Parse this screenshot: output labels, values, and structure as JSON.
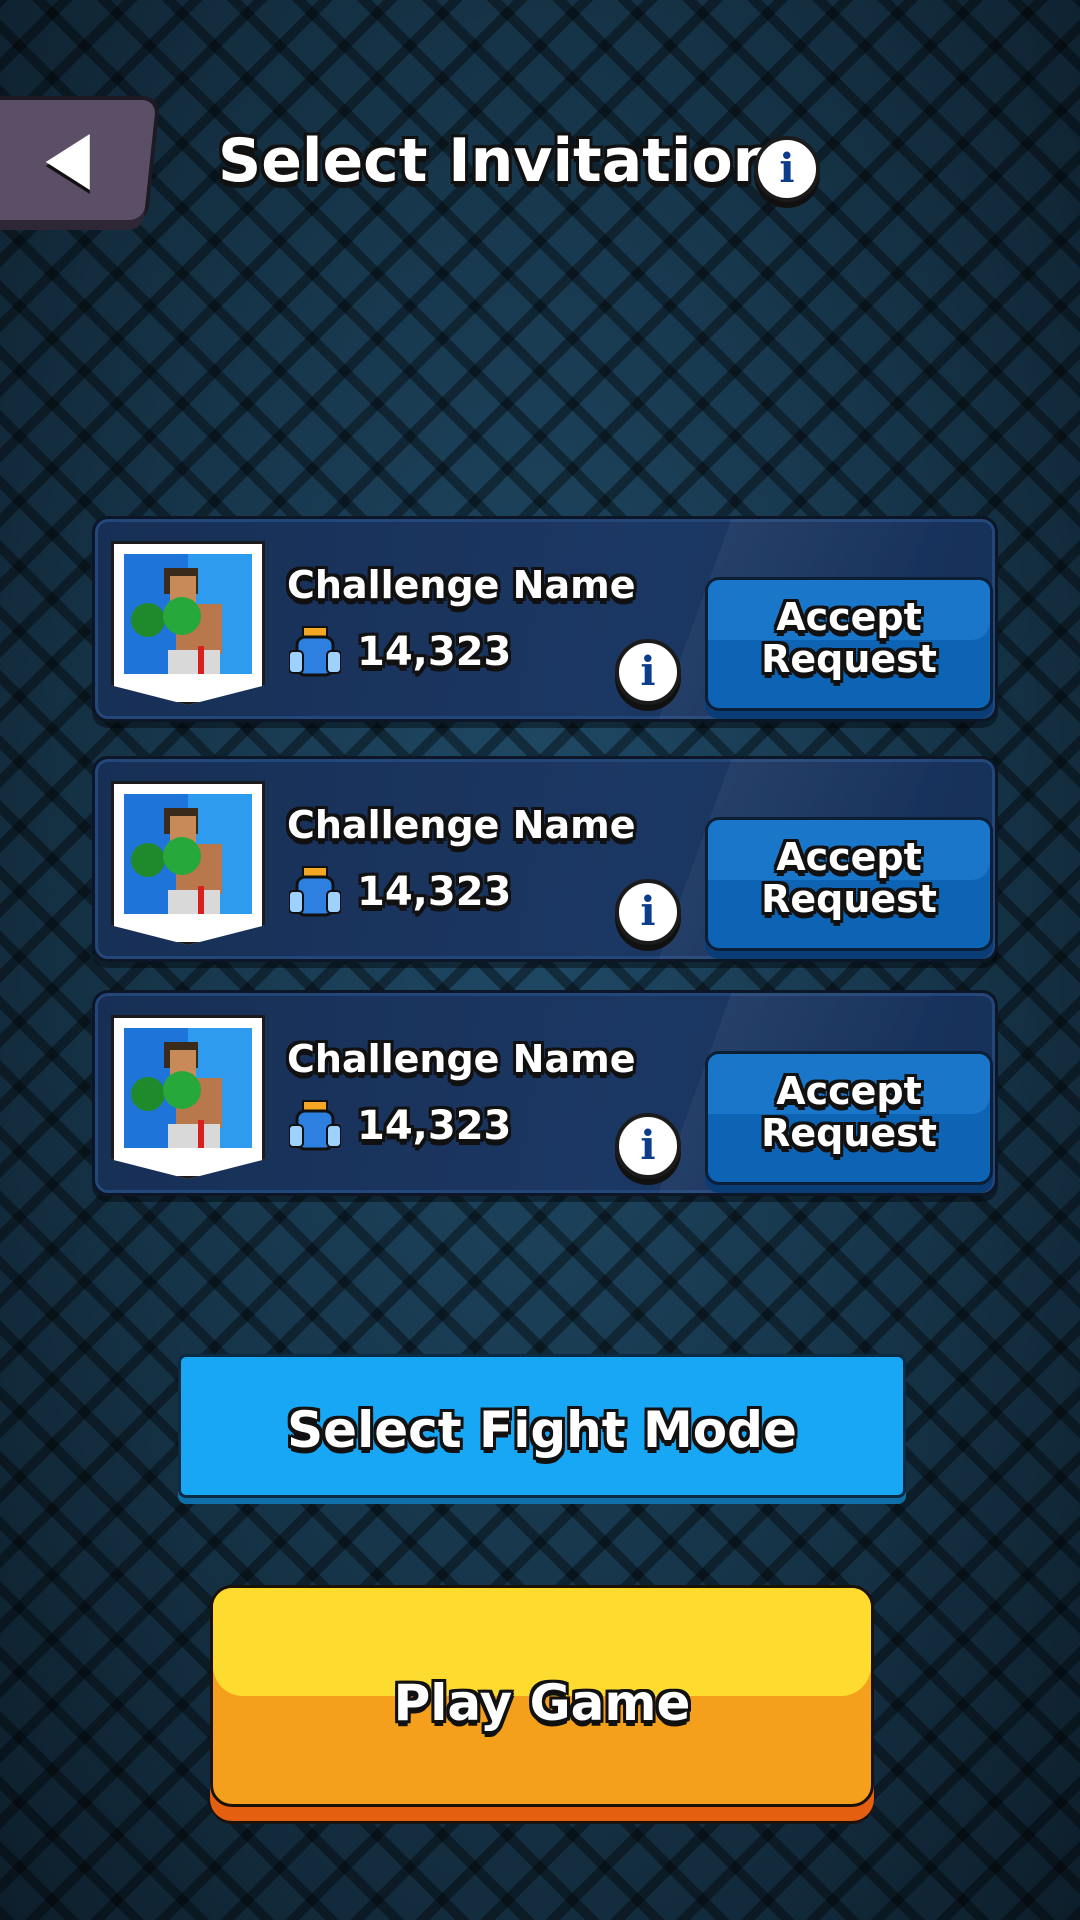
{
  "header": {
    "title": "Select Invitation"
  },
  "icons": {
    "back": "back-arrow-icon",
    "info": "info-icon",
    "trophy": "trophy-icon",
    "info_glyph": "i"
  },
  "invitations": [
    {
      "name": "Challenge Name",
      "trophies": "14,323",
      "accept_label": "Accept Request"
    },
    {
      "name": "Challenge Name",
      "trophies": "14,323",
      "accept_label": "Accept Request"
    },
    {
      "name": "Challenge Name",
      "trophies": "14,323",
      "accept_label": "Accept Request"
    }
  ],
  "actions": {
    "fight_mode_label": "Select Fight Mode",
    "play_label": "Play Game"
  },
  "colors": {
    "accept_button": "#0d63b4",
    "fight_mode_button": "#18a7f5",
    "play_button": "#fddb2f",
    "card_background": "#1b3763"
  }
}
